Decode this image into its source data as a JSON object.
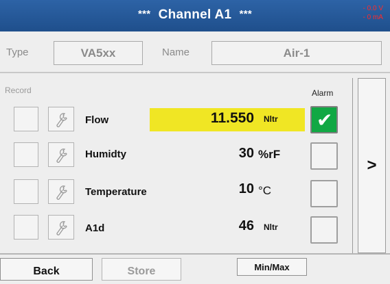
{
  "header": {
    "title_prefix": "***",
    "title": "Channel A1",
    "title_suffix": "***",
    "status_line1": "- 0.0 V",
    "status_line2": "- 0 mA",
    "status_color": "#ff2a2a",
    "bar_color": "#2258a0"
  },
  "info": {
    "type_label": "Type",
    "type_value": "VA5xx",
    "name_label": "Name",
    "name_value": "Air-1"
  },
  "table": {
    "record_label": "Record",
    "alarm_label": "Alarm",
    "highlight_color": "#f0e624",
    "alarm_on_color": "#11a844",
    "rows": [
      {
        "name": "Flow",
        "value": "11.550",
        "unit": "Nltr",
        "alarm": true,
        "icon": "wrench-icon"
      },
      {
        "name": "Humidty",
        "value": "30",
        "unit": "%rF",
        "alarm": false,
        "icon": "wrench-icon"
      },
      {
        "name": "Temperature",
        "value": "10",
        "unit": "°C",
        "alarm": false,
        "icon": "wrench-icon"
      },
      {
        "name": "A1d",
        "value": "46",
        "unit": "Nltr",
        "alarm": false,
        "icon": "wrench-icon"
      }
    ]
  },
  "nav": {
    "next_label": ">"
  },
  "footer": {
    "back_label": "Back",
    "store_label": "Store",
    "minmax_label": "Min/Max"
  }
}
